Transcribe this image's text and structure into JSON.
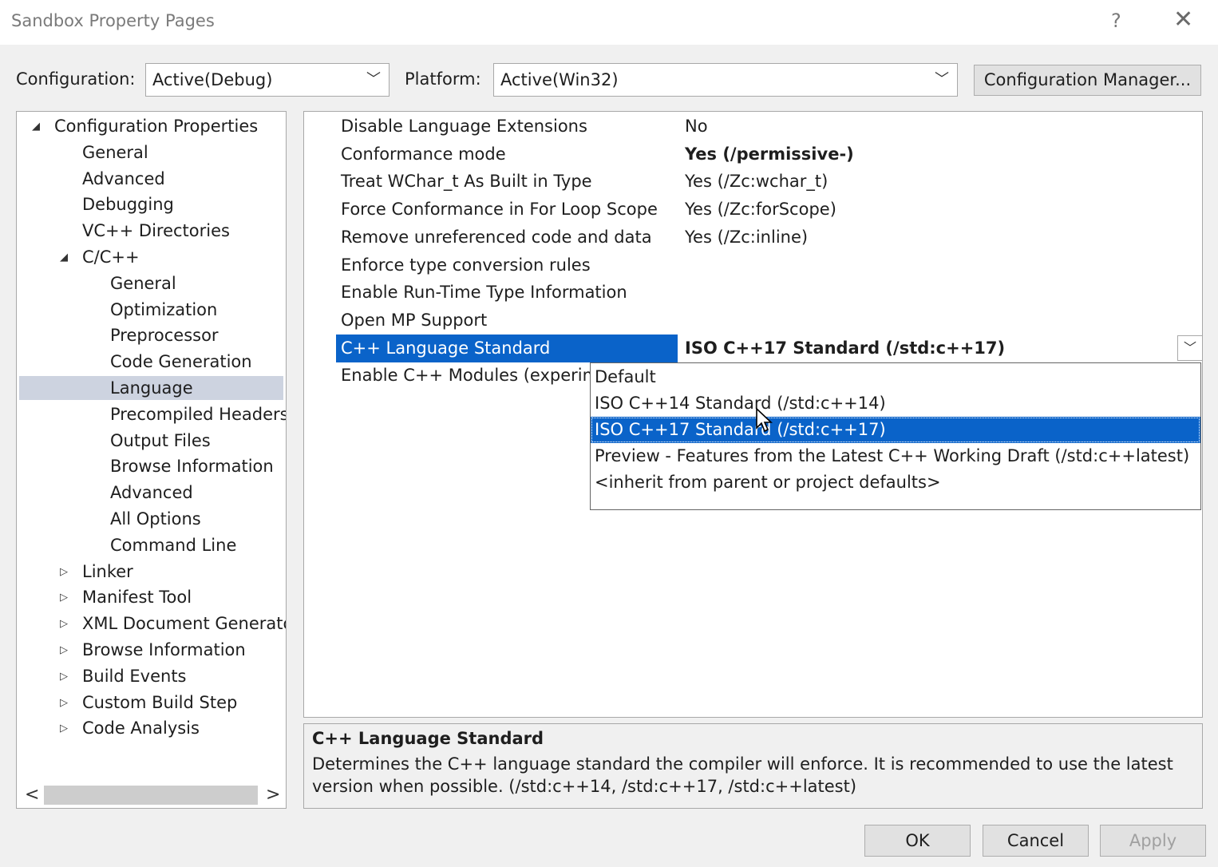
{
  "window": {
    "title": "Sandbox Property Pages",
    "help_glyph": "?",
    "close_glyph": "✕"
  },
  "config_bar": {
    "configuration_label": "Configuration:",
    "configuration_value": "Active(Debug)",
    "platform_label": "Platform:",
    "platform_value": "Active(Win32)",
    "config_manager_label": "Configuration Manager..."
  },
  "tree": {
    "items": [
      {
        "label": "Configuration Properties",
        "level": 0,
        "expander": "expanded"
      },
      {
        "label": "General",
        "level": 1,
        "expander": "none"
      },
      {
        "label": "Advanced",
        "level": 1,
        "expander": "none"
      },
      {
        "label": "Debugging",
        "level": 1,
        "expander": "none"
      },
      {
        "label": "VC++ Directories",
        "level": 1,
        "expander": "none"
      },
      {
        "label": "C/C++",
        "level": 1,
        "expander": "expanded"
      },
      {
        "label": "General",
        "level": 2,
        "expander": "none"
      },
      {
        "label": "Optimization",
        "level": 2,
        "expander": "none"
      },
      {
        "label": "Preprocessor",
        "level": 2,
        "expander": "none"
      },
      {
        "label": "Code Generation",
        "level": 2,
        "expander": "none"
      },
      {
        "label": "Language",
        "level": 2,
        "expander": "none",
        "selected": true
      },
      {
        "label": "Precompiled Headers",
        "level": 2,
        "expander": "none"
      },
      {
        "label": "Output Files",
        "level": 2,
        "expander": "none"
      },
      {
        "label": "Browse Information",
        "level": 2,
        "expander": "none"
      },
      {
        "label": "Advanced",
        "level": 2,
        "expander": "none"
      },
      {
        "label": "All Options",
        "level": 2,
        "expander": "none"
      },
      {
        "label": "Command Line",
        "level": 2,
        "expander": "none"
      },
      {
        "label": "Linker",
        "level": 1,
        "expander": "collapsed"
      },
      {
        "label": "Manifest Tool",
        "level": 1,
        "expander": "collapsed"
      },
      {
        "label": "XML Document Generator",
        "level": 1,
        "expander": "collapsed"
      },
      {
        "label": "Browse Information",
        "level": 1,
        "expander": "collapsed"
      },
      {
        "label": "Build Events",
        "level": 1,
        "expander": "collapsed"
      },
      {
        "label": "Custom Build Step",
        "level": 1,
        "expander": "collapsed"
      },
      {
        "label": "Code Analysis",
        "level": 1,
        "expander": "collapsed"
      }
    ],
    "scroll_left": "<",
    "scroll_right": ">"
  },
  "properties": {
    "rows": [
      {
        "name": "Disable Language Extensions",
        "value": "No",
        "bold": false
      },
      {
        "name": "Conformance mode",
        "value": "Yes (/permissive-)",
        "bold": true
      },
      {
        "name": "Treat WChar_t As Built in Type",
        "value": "Yes (/Zc:wchar_t)",
        "bold": false
      },
      {
        "name": "Force Conformance in For Loop Scope",
        "value": "Yes (/Zc:forScope)",
        "bold": false
      },
      {
        "name": "Remove unreferenced code and data",
        "value": "Yes (/Zc:inline)",
        "bold": false
      },
      {
        "name": "Enforce type conversion rules",
        "value": "",
        "bold": false
      },
      {
        "name": "Enable Run-Time Type Information",
        "value": "",
        "bold": false
      },
      {
        "name": "Open MP Support",
        "value": "",
        "bold": false
      },
      {
        "name": "C++ Language Standard",
        "value": "ISO C++17 Standard (/std:c++17)",
        "bold": true,
        "selected": true
      },
      {
        "name": "Enable C++ Modules (experimer",
        "value": "",
        "bold": false
      }
    ]
  },
  "dropdown": {
    "options": [
      {
        "label": "Default"
      },
      {
        "label": "ISO C++14 Standard (/std:c++14)"
      },
      {
        "label": "ISO C++17 Standard (/std:c++17)",
        "selected": true
      },
      {
        "label": "Preview - Features from the Latest C++ Working Draft (/std:c++latest)"
      },
      {
        "label": "<inherit from parent or project defaults>"
      }
    ]
  },
  "description": {
    "title": "C++ Language Standard",
    "text": "Determines the C++ language standard the compiler will enforce. It is recommended to use the latest version when possible. (/std:c++14, /std:c++17, /std:c++latest)"
  },
  "buttons": {
    "ok": "OK",
    "cancel": "Cancel",
    "apply": "Apply"
  },
  "colors": {
    "selection": "#0a63c9",
    "tree_selection": "#cdd3e0",
    "dialog_bg": "#f0f0f0"
  }
}
